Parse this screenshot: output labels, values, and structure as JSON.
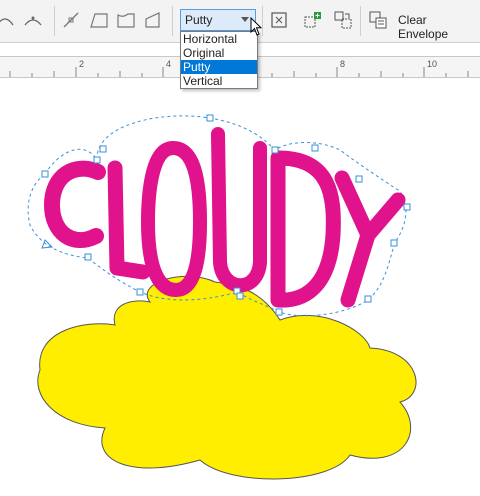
{
  "toolbar": {
    "mode_select_value": "Putty",
    "mode_options": [
      "Horizontal",
      "Original",
      "Putty",
      "Vertical"
    ],
    "selected_option": "Putty",
    "clear_envelope_label": "Clear Envelope"
  },
  "ruler": {
    "ticks": [
      "2",
      "4",
      "8",
      "10"
    ]
  },
  "canvas": {
    "text_object": "CLOUDY",
    "text_color": "#e0128c",
    "cloud_color": "#ffee00",
    "envelope_color": "#3a8fd8"
  }
}
